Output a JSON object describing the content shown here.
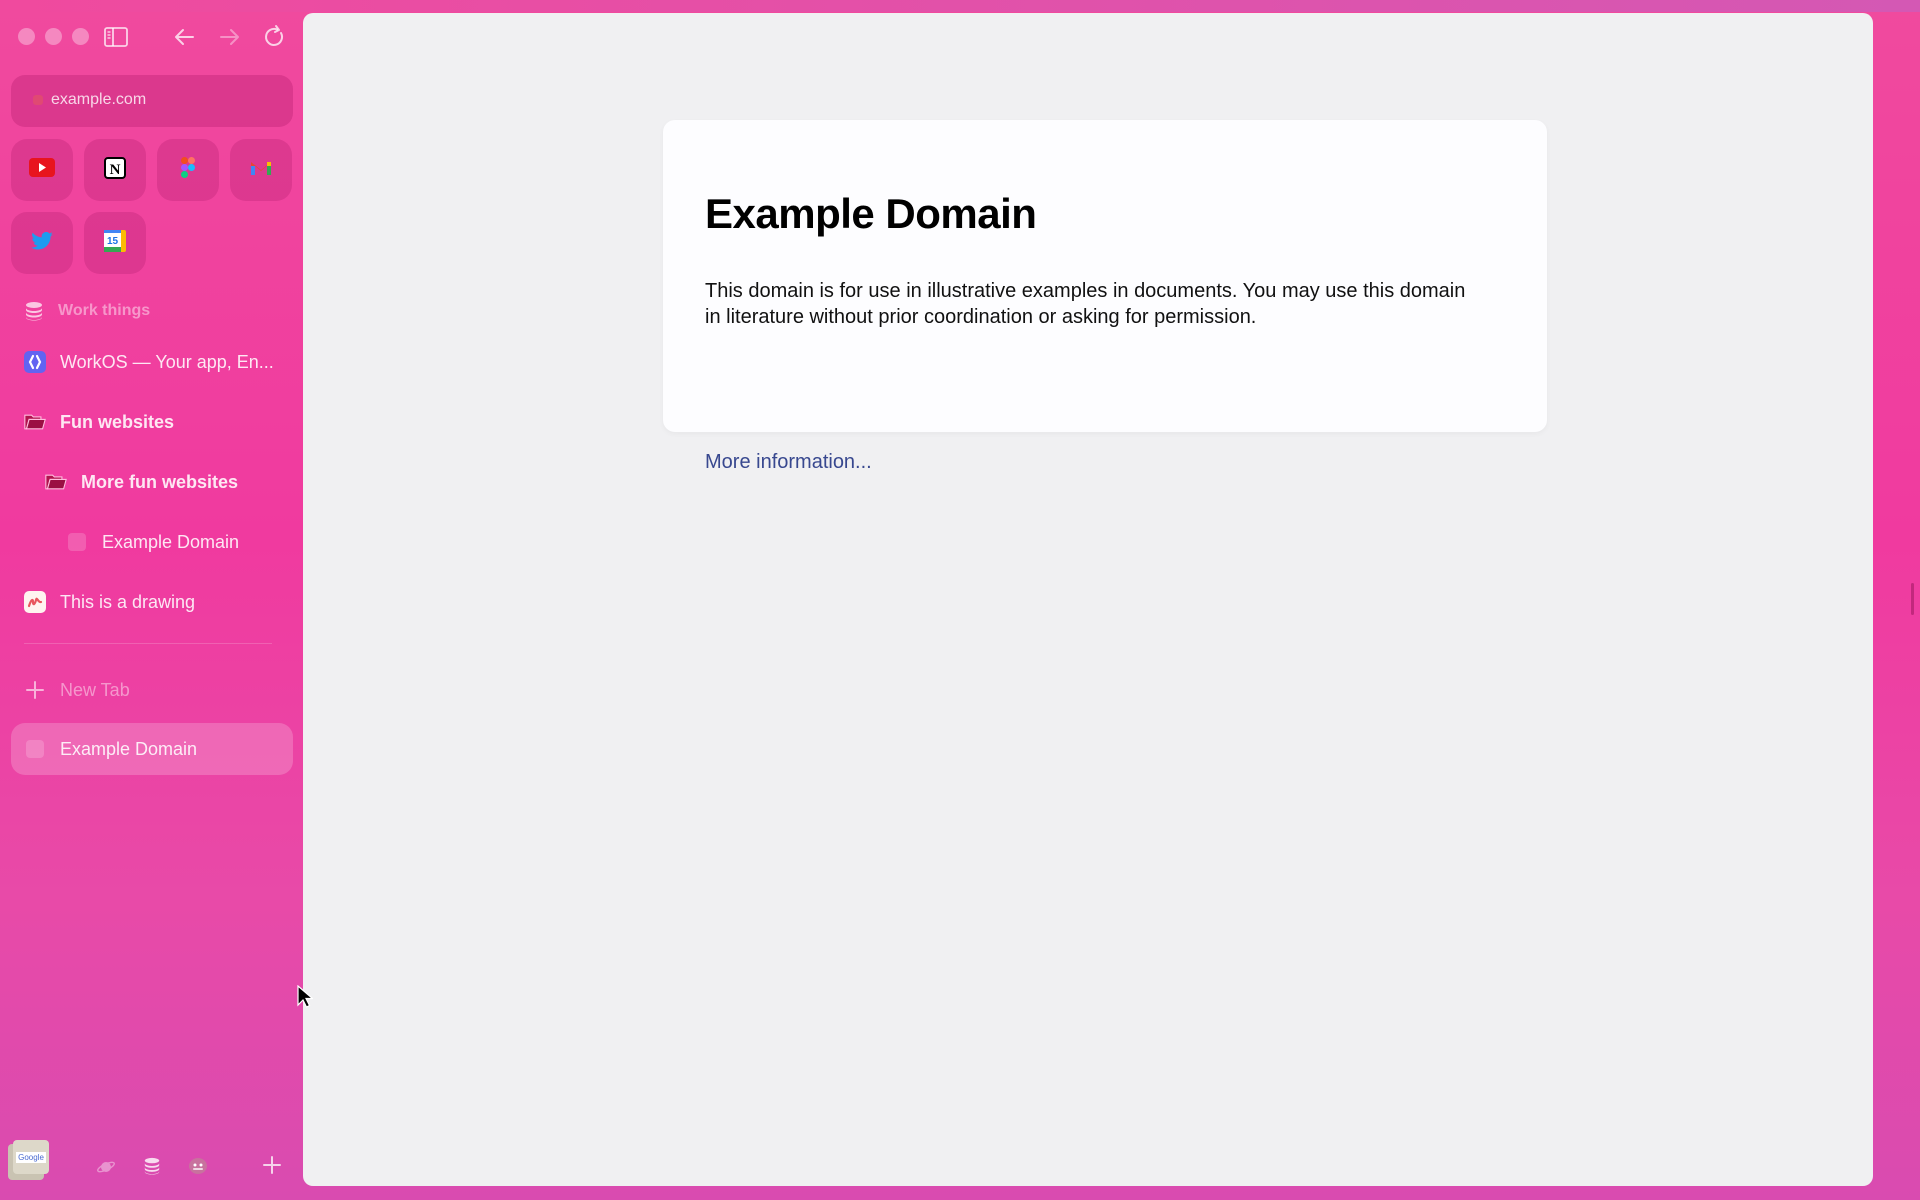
{
  "browser": {
    "url": "example.com",
    "toolbar": {
      "sidebar_toggle_icon": "sidebar-icon",
      "back_icon": "arrow-left-icon",
      "forward_icon": "arrow-right-icon",
      "reload_icon": "reload-icon"
    },
    "favorites": [
      {
        "name": "YouTube",
        "icon": "youtube-icon"
      },
      {
        "name": "Notion",
        "icon": "notion-icon"
      },
      {
        "name": "Figma",
        "icon": "figma-icon"
      },
      {
        "name": "Gmail",
        "icon": "gmail-icon"
      },
      {
        "name": "Twitter",
        "icon": "twitter-icon"
      },
      {
        "name": "Google Calendar",
        "icon": "calendar-icon",
        "badge": "15"
      }
    ],
    "space_label": "Work things",
    "pinned": [
      {
        "label": "WorkOS — Your app, En...",
        "icon": "workos-icon"
      },
      {
        "label": "Fun websites",
        "icon": "folder-icon",
        "type": "folder"
      },
      {
        "label": "More fun websites",
        "icon": "folder-icon",
        "type": "folder"
      },
      {
        "label": "Example Domain",
        "icon": "page-icon"
      },
      {
        "label": "This is a drawing",
        "icon": "drawing-icon"
      }
    ],
    "new_tab_label": "New Tab",
    "tabs": [
      {
        "label": "Example Domain",
        "active": true
      }
    ],
    "bottom_bar": {
      "archive_thumb_label": "Google",
      "icons": [
        "planet-icon",
        "stack-icon",
        "emoji-icon",
        "plus-icon"
      ]
    }
  },
  "page": {
    "title": "Example Domain",
    "body": "This domain is for use in illustrative examples in documents. You may use this domain in literature without prior coordination or asking for permission.",
    "link": "More information..."
  },
  "colors": {
    "sidebar_bg": "#f03a9f",
    "content_bg": "#f0f0f2",
    "card_bg": "#fdfdff",
    "link": "#38488f"
  }
}
